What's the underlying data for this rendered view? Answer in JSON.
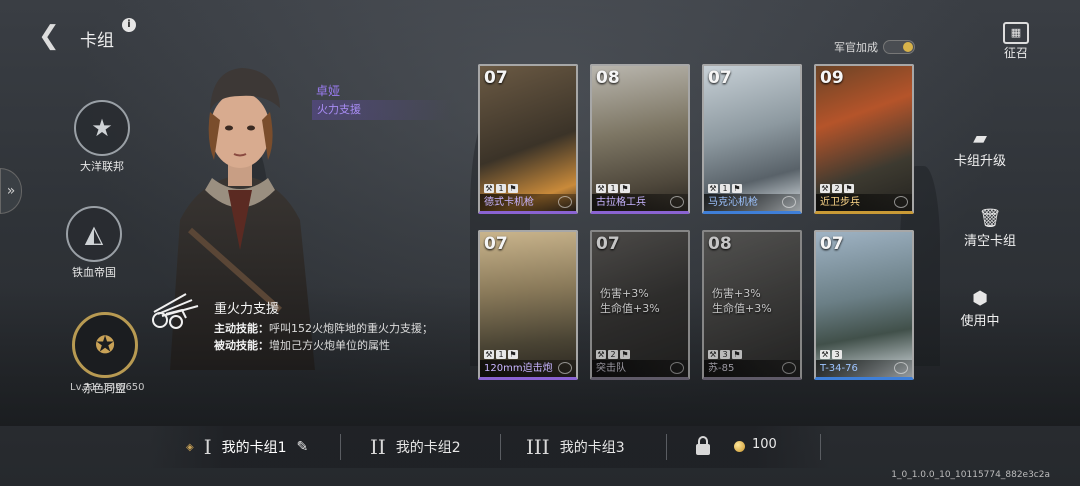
{
  "header": {
    "title": "卡组"
  },
  "factions": [
    {
      "label": "大洋联邦"
    },
    {
      "label": "铁血帝国"
    },
    {
      "label": "赤色同盟",
      "active": true
    }
  ],
  "player": {
    "level": "Lv.21",
    "xp": "340/650"
  },
  "officer": {
    "name": "卓娅",
    "role": "火力支援",
    "skill_title": "重火力支援",
    "active_label": "主动技能：",
    "active_text": "呼叫152火炮阵地的重火力支援；",
    "passive_label": "被动技能：",
    "passive_text": "增加己方火炮单位的属性"
  },
  "officer_bonus": {
    "label": "军官加成",
    "on": true
  },
  "cards": [
    {
      "cost": "07",
      "name": "德式卡机枪",
      "count": "1",
      "rarity": "purple"
    },
    {
      "cost": "08",
      "name": "古拉格工兵",
      "count": "1",
      "rarity": "purple"
    },
    {
      "cost": "07",
      "name": "马克沁机枪",
      "count": "1",
      "rarity": "blue"
    },
    {
      "cost": "09",
      "name": "近卫步兵",
      "count": "2",
      "rarity": "gold"
    },
    {
      "cost": "07",
      "name": "120mm迫击炮",
      "count": "1",
      "rarity": "purple"
    },
    {
      "cost": "07",
      "name": "突击队",
      "count": "2",
      "rarity": "purple",
      "buff": [
        "伤害+3%",
        "生命值+3%"
      ]
    },
    {
      "cost": "08",
      "name": "苏-85",
      "count": "3",
      "rarity": "purple",
      "buff": [
        "伤害+3%",
        "生命值+3%"
      ]
    },
    {
      "cost": "07",
      "name": "T-34-76",
      "count": "3",
      "rarity": "blue"
    }
  ],
  "right_menu": {
    "recruit": "征召",
    "upgrade": "卡组升级",
    "clear": "清空卡组",
    "use": "使用中"
  },
  "decks": [
    {
      "num": "I",
      "label": "我的卡组1"
    },
    {
      "num": "II",
      "label": "我的卡组2"
    },
    {
      "num": "III",
      "label": "我的卡组3"
    }
  ],
  "currency": "100",
  "version": "1_0_1.0.0_10_10115774_882e3c2a",
  "colors": {
    "accent_purple": "#8a63d2",
    "gold": "#c99a36",
    "blue": "#3f7fd8"
  }
}
